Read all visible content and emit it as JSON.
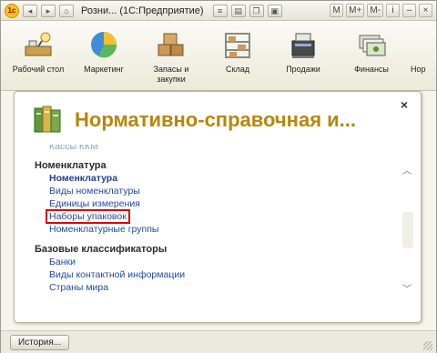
{
  "titlebar": {
    "title": "Розни... (1С:Предприятие)",
    "logo": "1с",
    "right_buttons": [
      "M",
      "M+",
      "M-"
    ]
  },
  "sections": [
    {
      "label": "Рабочий стол",
      "icon": "desktop-icon"
    },
    {
      "label": "Маркетинг",
      "icon": "pie-chart-icon"
    },
    {
      "label": "Запасы и закупки",
      "icon": "boxes-icon"
    },
    {
      "label": "Склад",
      "icon": "warehouse-icon"
    },
    {
      "label": "Продажи",
      "icon": "cash-register-icon"
    },
    {
      "label": "Финансы",
      "icon": "finance-icon"
    },
    {
      "label": "Нор",
      "icon": "reference-icon"
    }
  ],
  "panel": {
    "title": "Нормативно-справочная и...",
    "close": "×",
    "cut_item": "Кассы ККМ",
    "groups": [
      {
        "title": "Номенклатура",
        "items": [
          {
            "label": "Номенклатура",
            "bold": true
          },
          {
            "label": "Виды номенклатуры"
          },
          {
            "label": "Единицы измерения"
          },
          {
            "label": "Наборы упаковок",
            "highlight": true
          },
          {
            "label": "Номенклатурные группы"
          }
        ]
      },
      {
        "title": "Базовые классификаторы",
        "items": [
          {
            "label": "Банки"
          },
          {
            "label": "Виды контактной информации"
          },
          {
            "label": "Страны мира"
          }
        ]
      }
    ]
  },
  "statusbar": {
    "history_label": "История..."
  },
  "colors": {
    "title_gold": "#b7860a",
    "link_blue": "#1f4aa8",
    "highlight_red": "#dd0000"
  }
}
